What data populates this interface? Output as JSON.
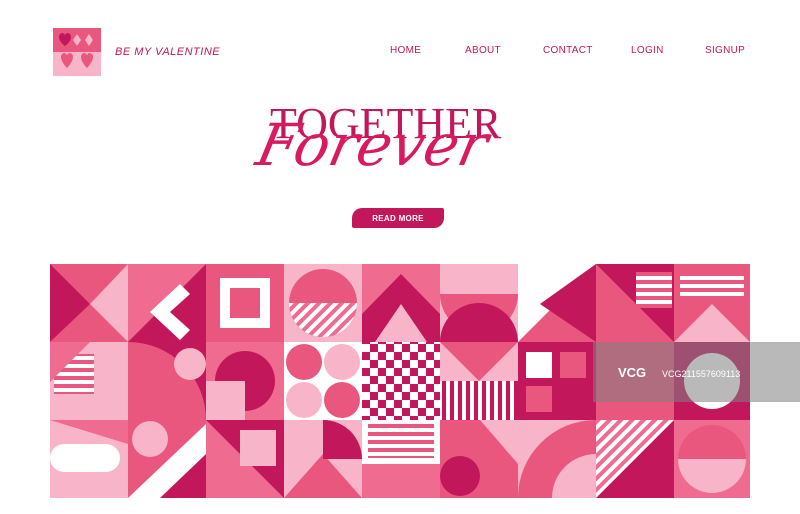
{
  "header": {
    "logo_icon": "hearts-logo-icon",
    "site_name": "BE MY VALENTINE"
  },
  "nav": {
    "items": [
      {
        "label": "HOME"
      },
      {
        "label": "ABOUT"
      },
      {
        "label": "CONTACT"
      },
      {
        "label": "LOGIN"
      },
      {
        "label": "SIGNUP"
      }
    ]
  },
  "hero": {
    "title": "TOGETHER",
    "script_title": "Forever",
    "cta_label": "READ MORE"
  },
  "watermark": {
    "logo": "VCG",
    "text": "VCG211557609113"
  },
  "colors": {
    "primary": "#c2185b",
    "accent": "#e9577f",
    "light": "#f8b4c8",
    "dark": "#b0124a"
  }
}
